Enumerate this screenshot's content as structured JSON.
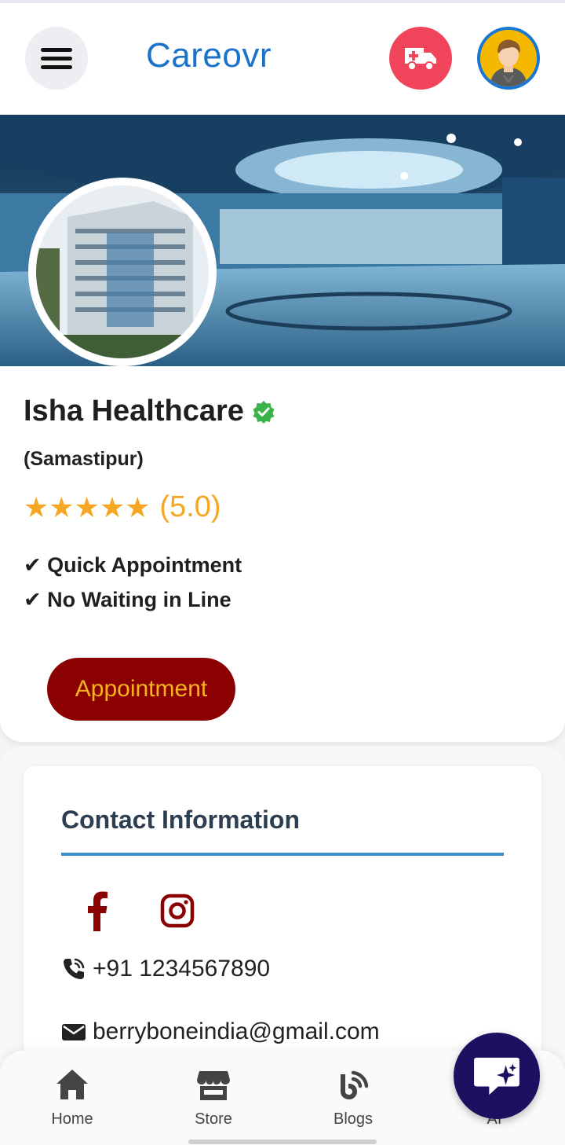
{
  "header": {
    "brand": "Careovr",
    "menu_icon": "hamburger-icon",
    "ambulance_icon": "ambulance-icon",
    "avatar_icon": "user-avatar"
  },
  "profile": {
    "name": "Isha Healthcare",
    "city": "(Samastipur)",
    "stars": "★★★★★",
    "rating_text": "(5.0)",
    "rating_value": 5.0,
    "features": [
      "✔ Quick Appointment",
      "✔ No Waiting in Line"
    ],
    "appointment_label": "Appointment"
  },
  "contact": {
    "title": "Contact Information",
    "phone": "+91 1234567890",
    "email": "berryboneindia@gmail.com"
  },
  "bottom_nav": {
    "items": [
      {
        "label": "Home",
        "icon": "home-icon"
      },
      {
        "label": "Store",
        "icon": "store-icon"
      },
      {
        "label": "Blogs",
        "icon": "blog-icon"
      },
      {
        "label": "AI",
        "icon": "ai-icon"
      }
    ]
  },
  "colors": {
    "brand": "#1a73c9",
    "ambulance": "#f0455a",
    "appointment_bg": "#8b0000",
    "appointment_text": "#f5b41e",
    "star": "#f5a623",
    "verified": "#3cb34a",
    "chat_fab": "#1e1060"
  }
}
